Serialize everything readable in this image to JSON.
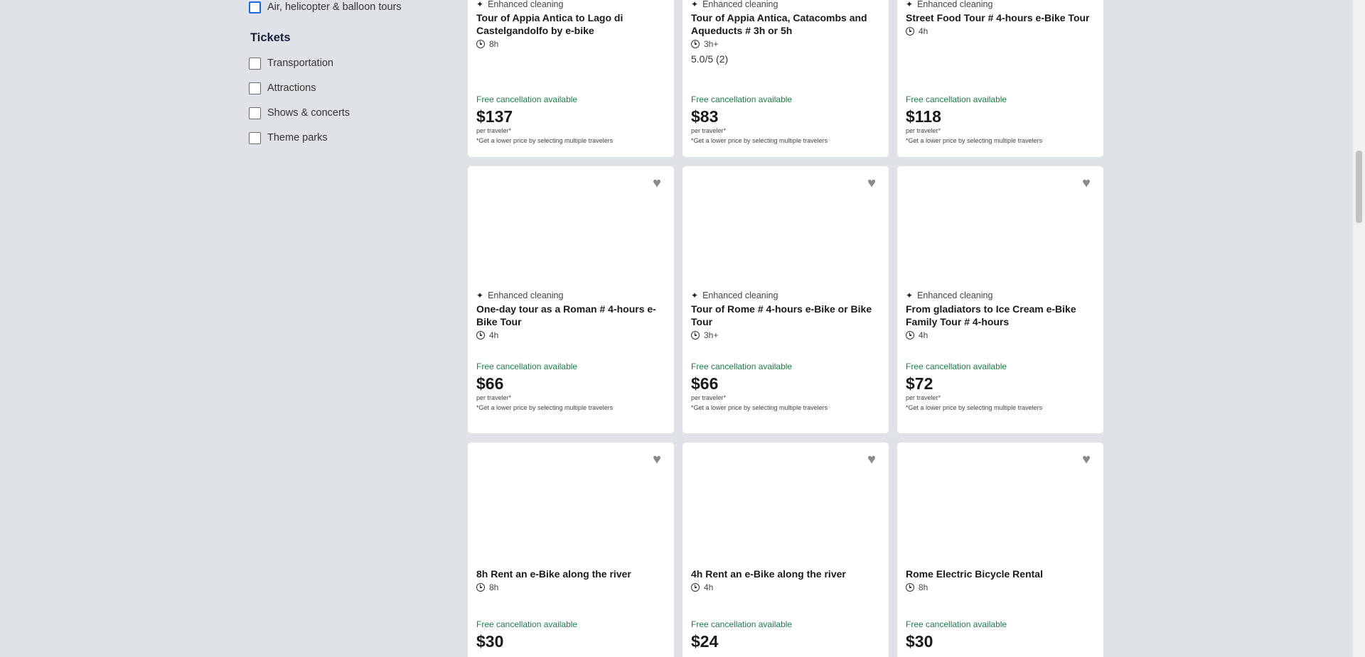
{
  "filters": {
    "air_label": "Air, helicopter & balloon tours",
    "tickets_title": "Tickets",
    "tickets": [
      "Transportation",
      "Attractions",
      "Shows & concerts",
      "Theme parks"
    ]
  },
  "common": {
    "enhanced_cleaning": "Enhanced cleaning",
    "free_cancellation": "Free cancellation available",
    "per_traveler": "per traveler*",
    "lower_price_note": "*Get a lower price by selecting multiple travelers"
  },
  "cards": [
    {
      "title": "Tour of Appia Antica to Lago di Castelgandolfo by e-bike",
      "duration": "8h",
      "price": "$137"
    },
    {
      "title": "Tour of Appia Antica, Catacombs and Aqueducts # 3h or 5h",
      "duration": "3h+",
      "rating": "5.0/5 (2)",
      "price": "$83"
    },
    {
      "title": "Street Food Tour # 4-hours e-Bike Tour",
      "duration": "4h",
      "price": "$118"
    },
    {
      "title": "One-day tour as a Roman # 4-hours e-Bike Tour",
      "duration": "4h",
      "price": "$66"
    },
    {
      "title": "Tour of Rome # 4-hours e-Bike or Bike Tour",
      "duration": "3h+",
      "price": "$66"
    },
    {
      "title": "From gladiators to Ice Cream e-Bike Family Tour # 4-hours",
      "duration": "4h",
      "price": "$72"
    },
    {
      "title": "8h Rent an e-Bike along the river",
      "duration": "8h",
      "price": "$30"
    },
    {
      "title": "4h Rent an e-Bike along the river",
      "duration": "4h",
      "price": "$24"
    },
    {
      "title": "Rome Electric Bicycle Rental",
      "duration": "8h",
      "price": "$30"
    }
  ],
  "icons": {
    "heart": "heart-icon",
    "clock": "clock-icon",
    "sparkle": "sparkle-icon"
  }
}
